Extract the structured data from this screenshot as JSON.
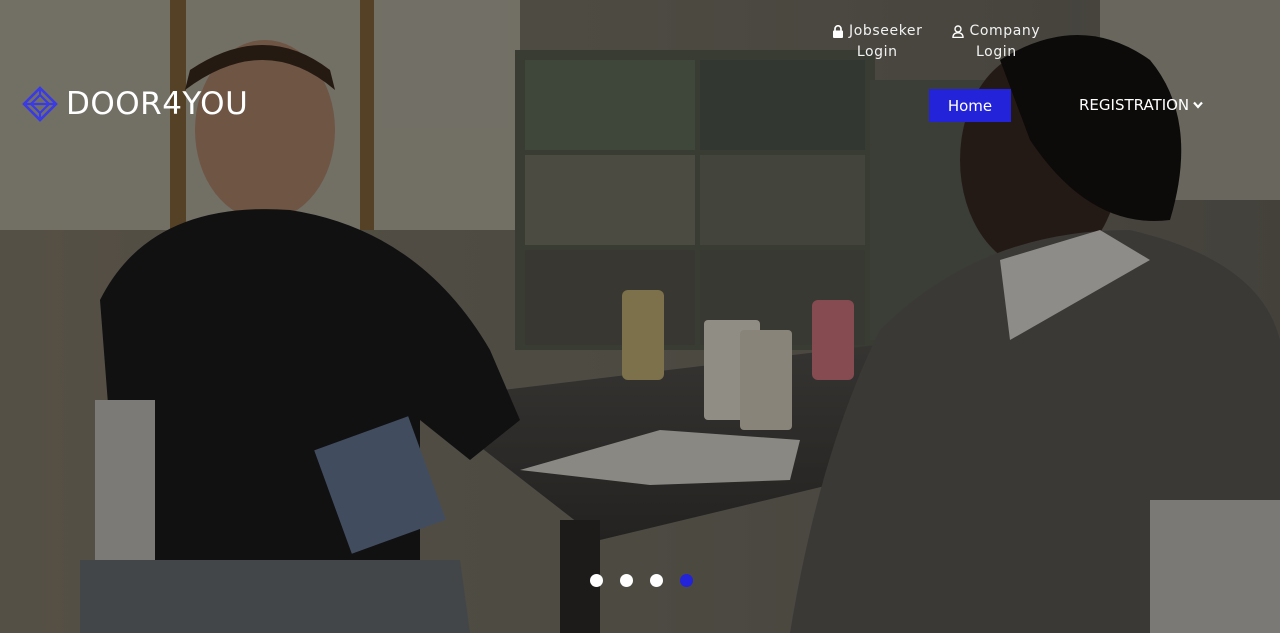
{
  "brand": {
    "name": "DOOR4YOU",
    "accent_color": "#2323d9"
  },
  "top_links": [
    {
      "icon": "lock-icon",
      "line1": "Jobseeker",
      "line2": "Login"
    },
    {
      "icon": "user-icon",
      "line1": "Company",
      "line2": "Login"
    }
  ],
  "nav": {
    "home_label": "Home",
    "registration_label": "REGISTRATION"
  },
  "carousel": {
    "slide_count": 4,
    "active_index": 3
  }
}
